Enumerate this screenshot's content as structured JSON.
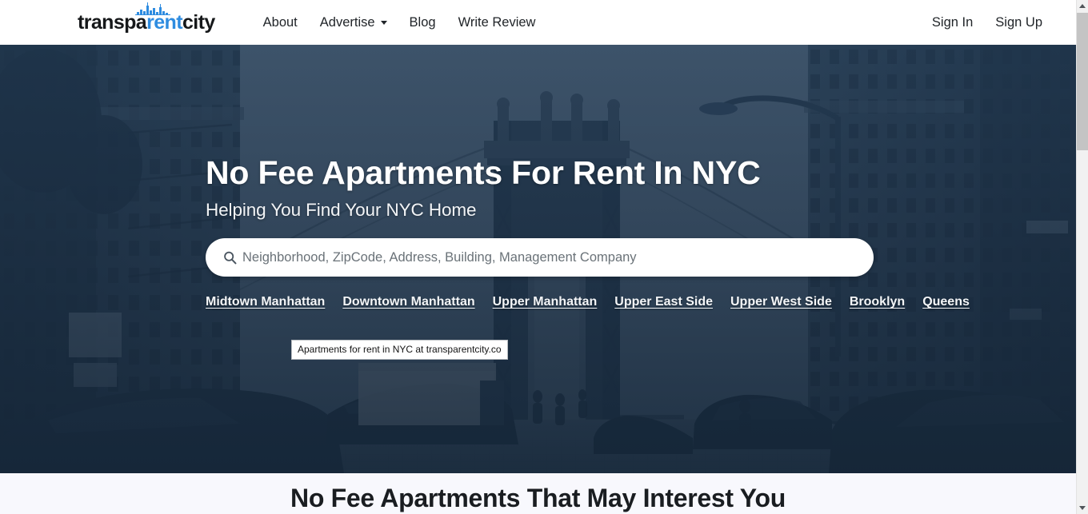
{
  "brand": {
    "text_pre": "transpa",
    "text_accent": "rent",
    "text_post": "city",
    "accent_color": "#2e8ce0",
    "skyline_icon": "city-skyline-icon"
  },
  "navbar": {
    "items": [
      {
        "label": "About",
        "has_caret": false
      },
      {
        "label": "Advertise",
        "has_caret": true
      },
      {
        "label": "Blog",
        "has_caret": false
      },
      {
        "label": "Write Review",
        "has_caret": false
      }
    ],
    "auth": [
      {
        "label": "Sign In"
      },
      {
        "label": "Sign Up"
      }
    ]
  },
  "hero": {
    "title": "No Fee Apartments For Rent In NYC",
    "subtitle": "Helping You Find Your NYC Home",
    "background_color": "#1e354d",
    "search": {
      "icon": "search-icon",
      "value": "",
      "placeholder": "Neighborhood, ZipCode, Address, Building, Management Company"
    },
    "neighborhoods": [
      "Midtown Manhattan",
      "Downtown Manhattan",
      "Upper Manhattan",
      "Upper East Side",
      "Upper West Side",
      "Brooklyn",
      "Queens"
    ]
  },
  "status_tooltip": {
    "text": "Apartments for rent in NYC at transparentcity.co"
  },
  "section": {
    "title": "No Fee Apartments That May Interest You",
    "background_color": "#f8f8fd"
  },
  "scrollbar": {
    "up_icon": "chevron-up-icon",
    "down_icon": "chevron-down-icon",
    "thumb": "scrollbar-thumb"
  }
}
